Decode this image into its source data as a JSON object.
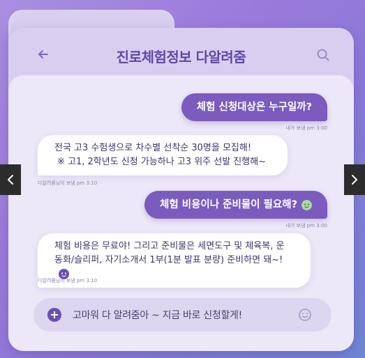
{
  "header": {
    "title": "진로체험정보 다알려줌",
    "back_icon": "arrow-left-icon",
    "search_icon": "search-icon"
  },
  "messages": [
    {
      "type": "sent",
      "text": "체험 신청대상은 누구일까?",
      "meta": "내가 보냄  pm 3:00"
    },
    {
      "type": "received",
      "lines": [
        "전국 고3 수험생으로 차수별 선착순 30명을 모집해!",
        "※ 고1, 2학년도 신청 가능하나 고3 위주 선발 진행해~"
      ],
      "meta": "다알려줌님이 보냄  pm 3:10"
    },
    {
      "type": "sent",
      "text": "체험 비용이나 준비물이 필요해?",
      "meta": "내가 보냄  pm 3:00",
      "emoji": "green-face-emoji"
    },
    {
      "type": "received",
      "lines": [
        "체험 비용은 무료야! 그리고 준비물은 세면도구 및 체육복, 운",
        "동화/슬리퍼, 자기소개서 1부(1분 발표 분량) 준비하면 돼~!"
      ],
      "meta": "다알려줌님이 보냄  pm 3:10",
      "emoji": "purple-face-emoji"
    }
  ],
  "input": {
    "value": "고마워 다 알려줌아 ~ 지금 바로 신청할게!",
    "plus_icon": "plus-icon",
    "emoji_icon": "smile-icon"
  },
  "carousel": {
    "prev_label": "‹",
    "next_label": "›"
  },
  "colors": {
    "accent": "#7b5bbd",
    "title": "#5b4aa6",
    "background": "#9b7bdc"
  }
}
